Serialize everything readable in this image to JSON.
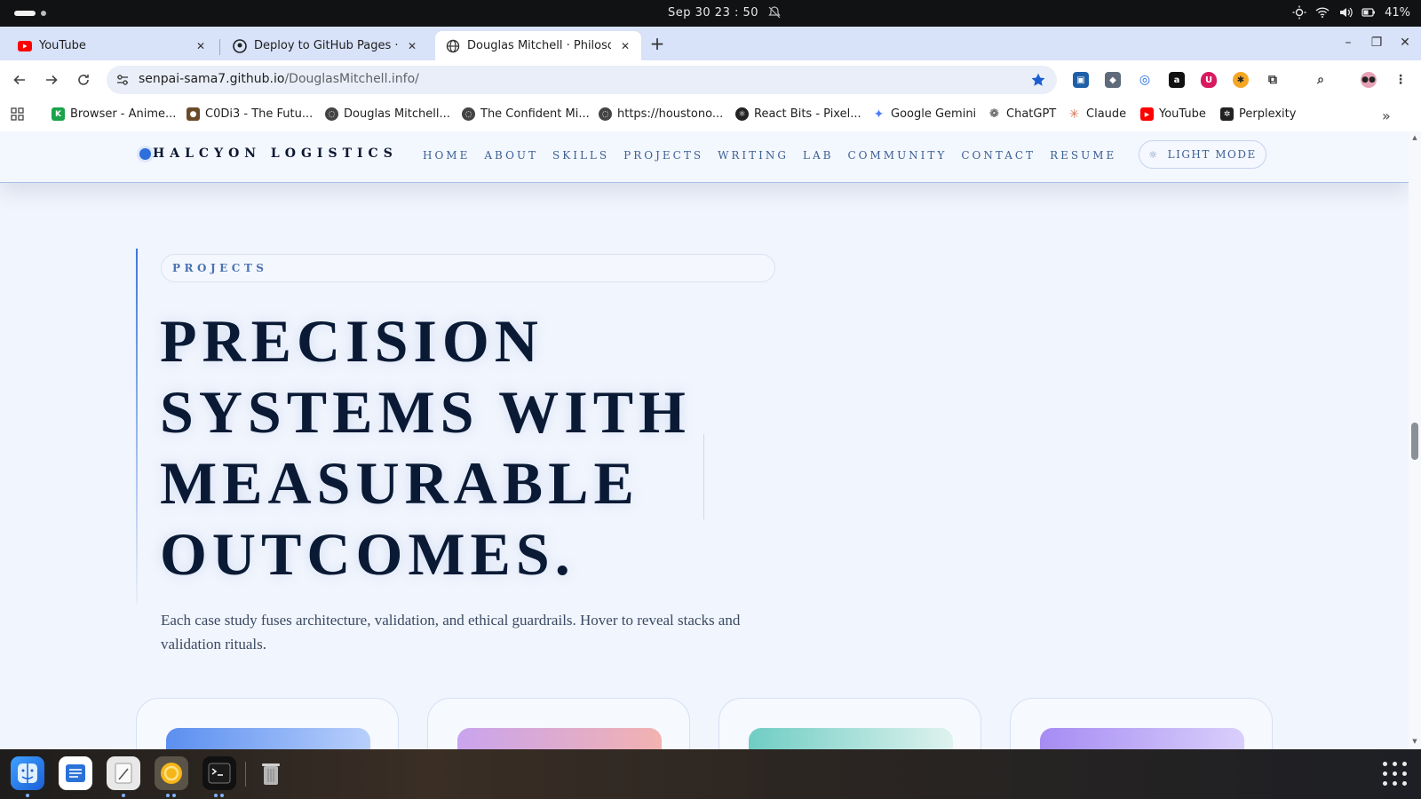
{
  "os": {
    "clock": "Sep 30  23 : 50",
    "battery": "41%"
  },
  "tabs": [
    {
      "title": "YouTube",
      "icon": "youtube-icon"
    },
    {
      "title": "Deploy to GitHub Pages · S",
      "icon": "github-icon"
    },
    {
      "title": "Douglas Mitchell · Philosop",
      "icon": "globe-icon",
      "active": true
    }
  ],
  "address": {
    "host": "senpai-sama7.github.io",
    "path": "/DouglasMitchell.info/"
  },
  "bookmarks": [
    {
      "label": "Browser - Anime...",
      "icon": "k-icon",
      "color": "#1aa34a"
    },
    {
      "label": "C0Di3 - The Futu...",
      "icon": "person-icon",
      "color": "#6b4a2a"
    },
    {
      "label": "Douglas Mitchell...",
      "icon": "globe-icon",
      "color": "#444444"
    },
    {
      "label": "The Confident Mi...",
      "icon": "globe-icon",
      "color": "#444444"
    },
    {
      "label": "https://houstono...",
      "icon": "globe-icon",
      "color": "#444444"
    },
    {
      "label": "React Bits - Pixel...",
      "icon": "reactbits-icon",
      "color": "#222222"
    },
    {
      "label": "Google Gemini",
      "icon": "gemini-icon",
      "color": "#4a7dff"
    },
    {
      "label": "ChatGPT",
      "icon": "chatgpt-icon",
      "color": "#333333"
    },
    {
      "label": "Claude",
      "icon": "claude-icon",
      "color": "#d97757"
    },
    {
      "label": "YouTube",
      "icon": "youtube-icon",
      "color": "#ff0000"
    },
    {
      "label": "Perplexity",
      "icon": "perplexity-icon",
      "color": "#222222"
    }
  ],
  "site": {
    "brand": "HALCYON LOGISTICS",
    "nav": [
      "HOME",
      "ABOUT",
      "SKILLS",
      "PROJECTS",
      "WRITING",
      "LAB",
      "COMMUNITY",
      "CONTACT",
      "RESUME"
    ],
    "mode_button": "LIGHT MODE",
    "eyebrow": "PROJECTS",
    "headline": [
      "PRECISION",
      "SYSTEMS WITH",
      "MEASURABLE",
      "OUTCOMES."
    ],
    "lede": "Each case study fuses architecture, validation, and ethical guardrails. Hover to reveal stacks and validation rituals.",
    "accent_color": "#2f6fdc"
  },
  "colors": {
    "tab_strip": "#d8e2f8",
    "page_bg": "#f1f5fd",
    "headline": "#0a1a35"
  }
}
